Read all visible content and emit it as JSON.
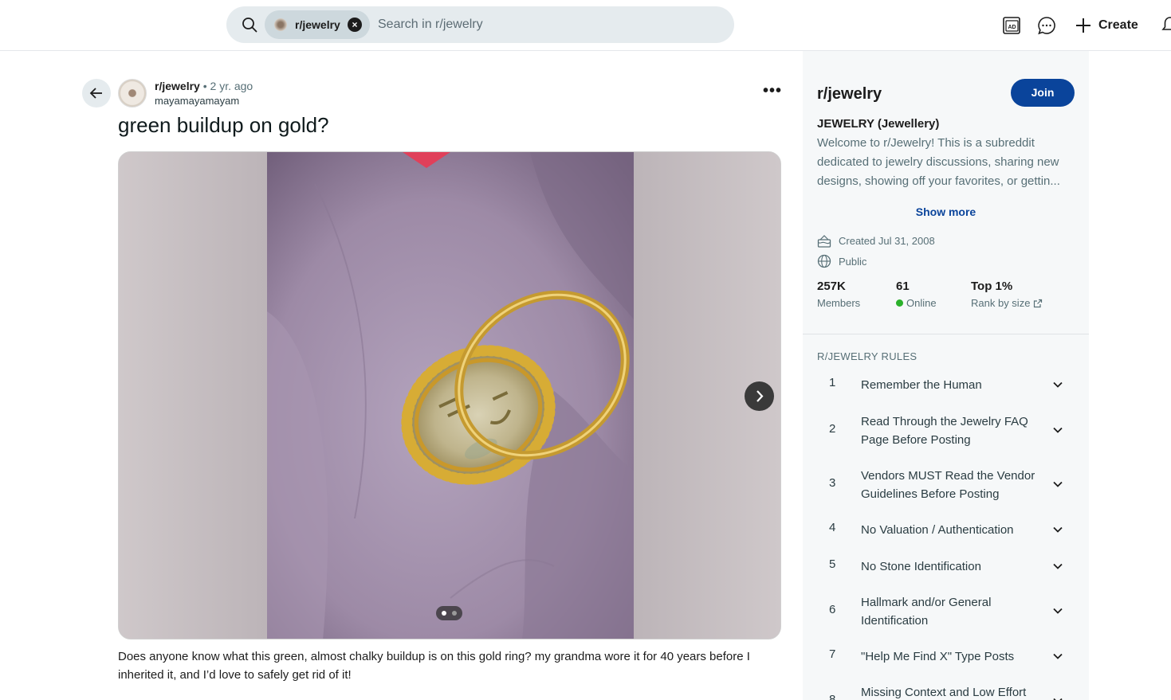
{
  "header": {
    "search_chip_label": "r/jewelry",
    "search_placeholder": "Search in r/jewelry",
    "create_label": "Create",
    "icons": [
      "search-icon",
      "ad-icon",
      "chat-icon",
      "plus-icon",
      "bell-icon"
    ]
  },
  "post": {
    "subreddit": "r/jewelry",
    "separator": "•",
    "age": "2 yr. ago",
    "author": "mayamayamayam",
    "more": "•••",
    "title": "green buildup on gold?",
    "gallery": {
      "current": 1,
      "total": 2
    },
    "body": "Does anyone know what this green, almost chalky buildup is on this gold ring? my grandma wore it for 40 years before I inherited it, and I’d love to safely get rid of it!"
  },
  "sidebar": {
    "name": "r/jewelry",
    "join_label": "Join",
    "long_title": "JEWELRY (Jewellery)",
    "description": "Welcome to r/Jewelry! This is a subreddit dedicated to jewelry discussions, sharing new designs, showing off your favorites, or gettin...",
    "show_more": "Show more",
    "created": "Created Jul 31, 2008",
    "visibility": "Public",
    "stats": [
      {
        "value": "257K",
        "label": "Members"
      },
      {
        "value": "61",
        "label": "Online"
      },
      {
        "value": "Top 1%",
        "label": "Rank by size"
      }
    ],
    "rules_heading": "R/JEWELRY RULES",
    "rules": [
      {
        "n": "1",
        "text": "Remember the Human"
      },
      {
        "n": "2",
        "text": "Read Through the Jewelry FAQ Page Before Posting"
      },
      {
        "n": "3",
        "text": "Vendors MUST Read the Vendor Guidelines Before Posting"
      },
      {
        "n": "4",
        "text": "No Valuation / Authentication"
      },
      {
        "n": "5",
        "text": "No Stone Identification"
      },
      {
        "n": "6",
        "text": "Hallmark and/or General Identification"
      },
      {
        "n": "7",
        "text": "\"Help Me Find X\" Type Posts"
      },
      {
        "n": "8",
        "text": "Missing Context and Low Effort"
      }
    ],
    "colors": {
      "join": "#0a449b",
      "online": "#2bb12b"
    }
  }
}
